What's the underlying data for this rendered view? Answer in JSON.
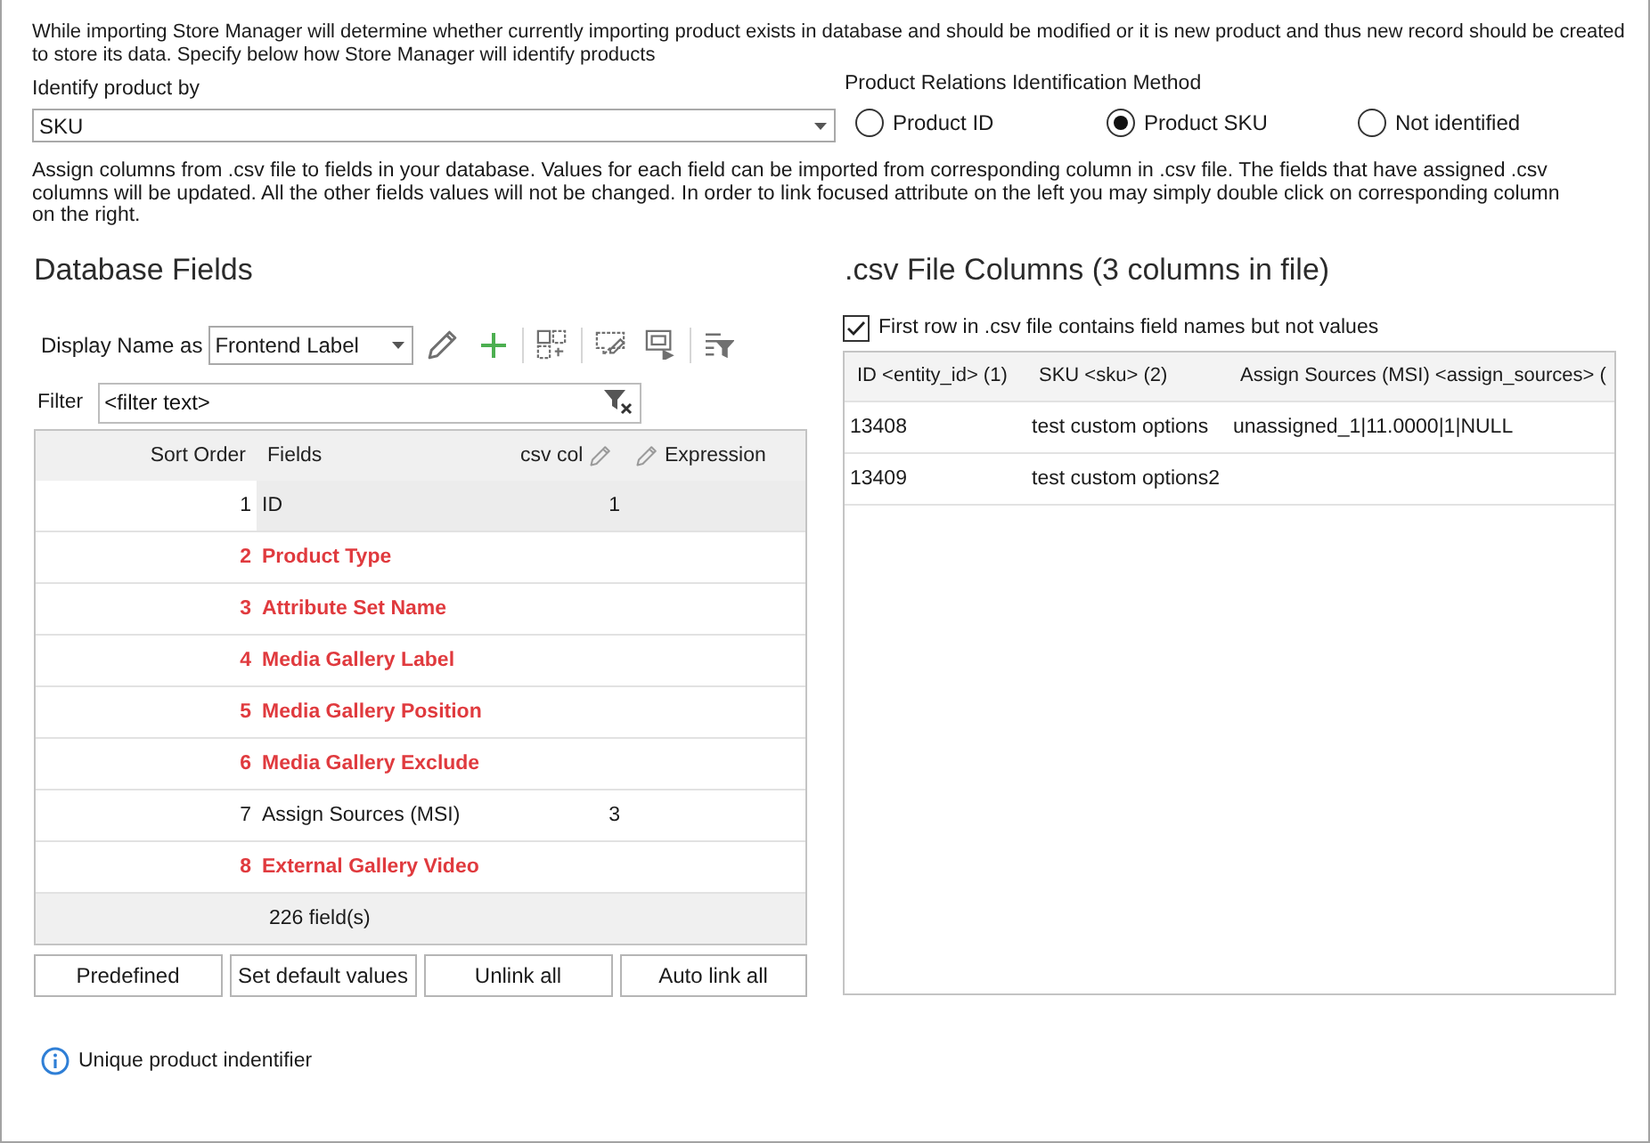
{
  "intro": "While importing Store Manager will determine whether currently importing product exists in database and should be modified or it is new product and thus new record should be created to store its data. Specify below how Store Manager will identify products",
  "identify": {
    "label": "Identify product by",
    "value": "SKU"
  },
  "relations": {
    "label": "Product Relations Identification Method",
    "options": [
      {
        "label": "Product ID",
        "selected": false
      },
      {
        "label": "Product SKU",
        "selected": true
      },
      {
        "label": "Not identified",
        "selected": false
      }
    ]
  },
  "assign_note": "Assign columns from .csv file to fields in your database. Values for each field can be imported from corresponding column in .csv file. The fields that have assigned .csv columns will be updated. All the other fields values will not be changed. In order to link focused attribute on the left you may simply double click on corresponding column on the right.",
  "database_fields": {
    "title": "Database Fields",
    "display_name": {
      "label": "Display Name as",
      "value": "Frontend Label"
    },
    "filter": {
      "label": "Filter",
      "placeholder": "<filter text>"
    },
    "columns": [
      {
        "label": "Sort Order",
        "kind": "plain"
      },
      {
        "label": "Fields",
        "kind": "plain"
      },
      {
        "label": "csv col",
        "kind": "trailing"
      },
      {
        "label": "Expression",
        "kind": "leading"
      }
    ],
    "rows": [
      {
        "sort_order": "1",
        "field": "ID",
        "csv_col": "1",
        "selected": true,
        "required": false
      },
      {
        "sort_order": "2",
        "field": "Product Type",
        "selected": false,
        "required": true
      },
      {
        "sort_order": "3",
        "field": "Attribute Set Name",
        "selected": false,
        "required": true
      },
      {
        "sort_order": "4",
        "field": "Media Gallery Label",
        "selected": false,
        "required": true
      },
      {
        "sort_order": "5",
        "field": "Media Gallery Position",
        "selected": false,
        "required": true
      },
      {
        "sort_order": "6",
        "field": "Media Gallery Exclude",
        "selected": false,
        "required": true
      },
      {
        "sort_order": "7",
        "field": "Assign Sources (MSI)",
        "csv_col": "3",
        "selected": false,
        "required": false
      },
      {
        "sort_order": "8",
        "field": "External Gallery Video",
        "selected": false,
        "required": true
      }
    ],
    "footer": "226 field(s)"
  },
  "buttons": [
    "Predefined",
    "Set default values",
    "Unlink all",
    "Auto link all"
  ],
  "info": "Unique product indentifier",
  "csv_columns": {
    "title": ".csv File Columns (3 columns in file)",
    "first_row": {
      "label": "First row in .csv file contains field names but not values",
      "checked": true
    },
    "columns": [
      "ID <entity_id> (1)",
      "SKU <sku> (2)",
      "Assign Sources (MSI) <assign_sources> ("
    ],
    "rows": [
      [
        "13408",
        "test custom options",
        "unassigned_1|11.0000|1|NULL"
      ],
      [
        "13409",
        "test custom options2"
      ]
    ]
  }
}
